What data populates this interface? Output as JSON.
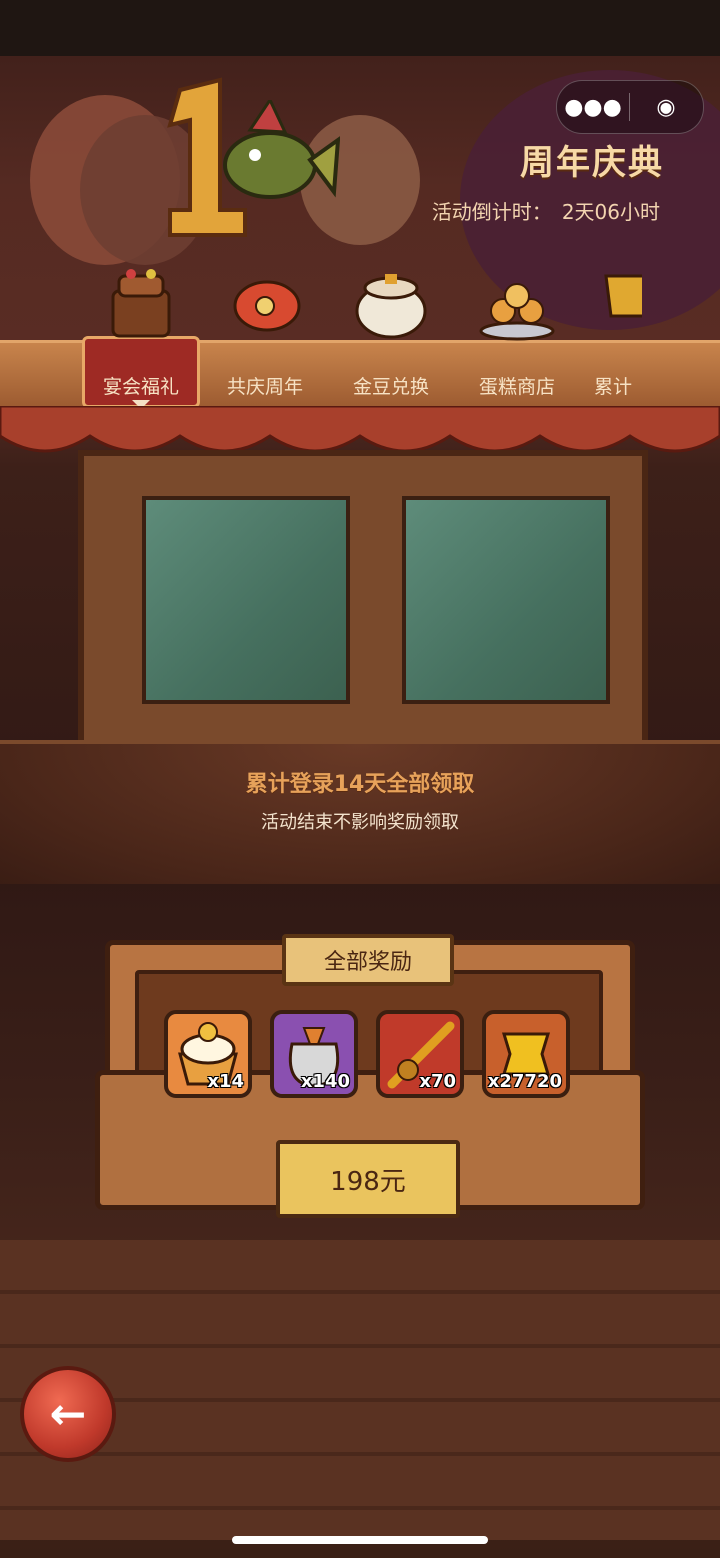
{
  "header": {
    "title": "周年庆典",
    "countdown_label": "活动倒计时：",
    "countdown_value": "2天06小时",
    "menu_icon": "more-dots-icon",
    "close_icon": "target-close-icon"
  },
  "tabs": [
    {
      "label": "宴会福礼",
      "icon": "cake-icon",
      "active": true
    },
    {
      "label": "共庆周年",
      "icon": "fish-icon",
      "active": false
    },
    {
      "label": "金豆兑换",
      "icon": "treasure-pot-icon",
      "active": false
    },
    {
      "label": "蛋糕商店",
      "icon": "cake-stand-icon",
      "active": false
    },
    {
      "label": "累计",
      "icon": "trophy-icon",
      "active": false
    }
  ],
  "stage": {
    "line1": "累计登录14天全部领取",
    "line2": "活动结束不影响奖励领取"
  },
  "rewards": {
    "header": "全部奖励",
    "items": [
      {
        "name": "cake-icon",
        "qty": "x14"
      },
      {
        "name": "bag-icon",
        "qty": "x140"
      },
      {
        "name": "fishing-rod-icon",
        "qty": "x70"
      },
      {
        "name": "gold-bone-icon",
        "qty": "x27720"
      }
    ],
    "price": "198元"
  },
  "colors": {
    "accent": "#e7a25a",
    "active_tab": "#9e2a24",
    "price_bg": "#eac45e"
  }
}
